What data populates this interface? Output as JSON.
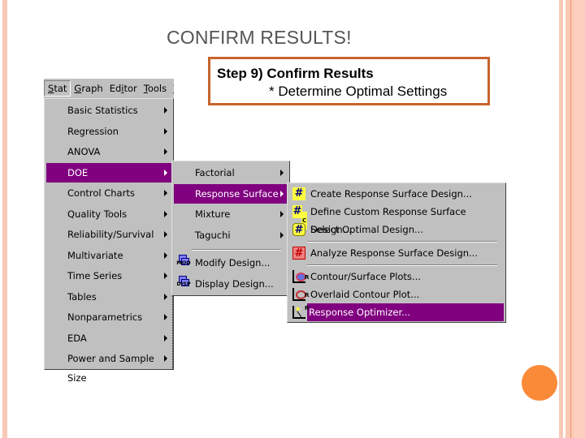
{
  "slide": {
    "title": "CONFIRM RESULTS!",
    "step_box": {
      "line1": "Step 9) Confirm Results",
      "line2": "* Determine Optimal Settings"
    },
    "colors": {
      "accent_stripe": "#f9c9b6",
      "dot": "#fb8a38",
      "box_border": "#c8642c",
      "menu_highlight": "#800080",
      "menu_bg": "#c0c0c0"
    }
  },
  "menubar": {
    "items": [
      {
        "label_u": "S",
        "label_rest": "tat",
        "active": true
      },
      {
        "label_u": "G",
        "label_rest": "raph"
      },
      {
        "label_pre": "Ed",
        "label_u": "i",
        "label_rest": "tor"
      },
      {
        "label_u": "T",
        "label_rest": "ools"
      },
      {
        "label_u": "W",
        "label_rest": ""
      }
    ]
  },
  "stat_menu": {
    "items": [
      {
        "label": "Basic Statistics",
        "submenu": true
      },
      {
        "label": "Regression",
        "submenu": true
      },
      {
        "label": "ANOVA",
        "submenu": true
      },
      {
        "label": "DOE",
        "submenu": true,
        "highlighted": true
      },
      {
        "label": "Control Charts",
        "submenu": true
      },
      {
        "label": "Quality Tools",
        "submenu": true
      },
      {
        "label": "Reliability/Survival",
        "submenu": true
      },
      {
        "label": "Multivariate",
        "submenu": true
      },
      {
        "label": "Time Series",
        "submenu": true
      },
      {
        "label": "Tables",
        "submenu": true
      },
      {
        "label": "Nonparametrics",
        "submenu": true
      },
      {
        "label": "EDA",
        "submenu": true
      },
      {
        "label": "Power and Sample Size",
        "submenu": true
      }
    ]
  },
  "doe_menu": {
    "items": [
      {
        "label": "Factorial",
        "submenu": true
      },
      {
        "label": "Response Surface",
        "submenu": true,
        "highlighted": true
      },
      {
        "label": "Mixture",
        "submenu": true
      },
      {
        "label": "Taguchi",
        "submenu": true
      },
      {
        "label": "Modify Design...",
        "icon": "modify-design-icon",
        "icon_text": "MOD"
      },
      {
        "label": "Display Design...",
        "icon": "display-design-icon",
        "icon_text": "DISP"
      }
    ]
  },
  "response_surface_menu": {
    "items": [
      {
        "label": "Create Response Surface Design...",
        "icon": "create-design-grid-icon"
      },
      {
        "label": "Define Custom Response Surface Design...",
        "icon": "define-custom-grid-icon",
        "icon_sub": "C"
      },
      {
        "label": "Select Optimal Design...",
        "icon": "select-optimal-grid-icon"
      },
      {
        "label": "Analyze Response Surface Design...",
        "icon": "analyze-grid-icon"
      },
      {
        "label": "Contour/Surface Plots...",
        "icon": "contour-plot-icon",
        "icon_sub": "R"
      },
      {
        "label": "Overlaid Contour Plot...",
        "icon": "overlaid-contour-icon",
        "icon_sub": "R"
      },
      {
        "label": "Response Optimizer...",
        "icon": "response-optimizer-icon",
        "icon_sub": "R",
        "highlighted": true
      }
    ]
  }
}
